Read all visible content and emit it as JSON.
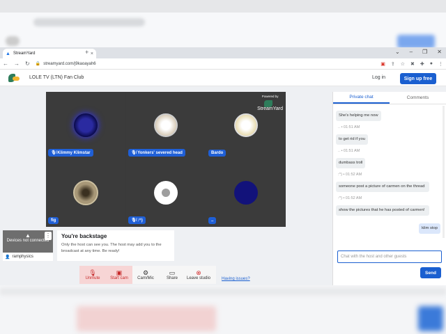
{
  "browser": {
    "tab_title": "StreamYard",
    "url": "streamyard.com/j9kaoayah6"
  },
  "app": {
    "club_name": "LOLE TV (LTN) Fan Club",
    "login_label": "Log in",
    "signup_label": "Sign up free"
  },
  "stage": {
    "powered_by": "Powered by",
    "brand": "StreamYard",
    "participants": [
      {
        "name": "Klimmy Klimstar",
        "mic_icon": "mic-muted-icon",
        "avatar_color": "#1a1a8a"
      },
      {
        "name": "Yonkers' severed head",
        "mic_icon": "mic-muted-icon",
        "avatar_color": "#e8e0d0"
      },
      {
        "name": "Bardo",
        "mic_icon": "",
        "avatar_color": "#f2ead0"
      },
      {
        "name": "fig",
        "mic_icon": "",
        "avatar_color": "#8a7a60"
      },
      {
        "name": ":^)",
        "mic_icon": "mic-muted-icon",
        "avatar_color": "#ffffff"
      },
      {
        "name": "..",
        "mic_icon": "",
        "avatar_color": "#12127a"
      }
    ]
  },
  "backstage": {
    "device_status": "Devices not connected",
    "username": "ramphysics",
    "title": "You're backstage",
    "description": "Only the host can see you. The host may add you to the broadcast at any time. Be ready!"
  },
  "controls": {
    "unmute": "Unmute",
    "start_cam": "Start cam",
    "cam_mic": "Cam/Mic",
    "share": "Share",
    "leave_studio": "Leave studio",
    "help_link": "Having issues?"
  },
  "chat": {
    "tab_private": "Private chat",
    "tab_comments": "Comments",
    "messages": [
      {
        "meta": "",
        "text": "She's helping me now",
        "mine": false
      },
      {
        "meta": ".. • 01:51 AM",
        "text": "to get rid if you",
        "mine": false
      },
      {
        "meta": ".. • 01:51 AM",
        "text": "dumbass troll",
        "mine": false
      },
      {
        "meta": ":^) • 01:52 AM",
        "text": "someone post a picture of carmen on the thread",
        "mine": false
      },
      {
        "meta": ":^) • 01:52 AM",
        "text": "show the pictures that he has posted of carmen!",
        "mine": false
      },
      {
        "meta": "",
        "text": "klim stop",
        "mine": true
      }
    ],
    "input_placeholder": "Chat with the host and other guests",
    "send_label": "Send"
  },
  "colors": {
    "accent": "#1a5fd0",
    "tile_bg": "#3b3b3b",
    "danger": "#d32f2f"
  }
}
